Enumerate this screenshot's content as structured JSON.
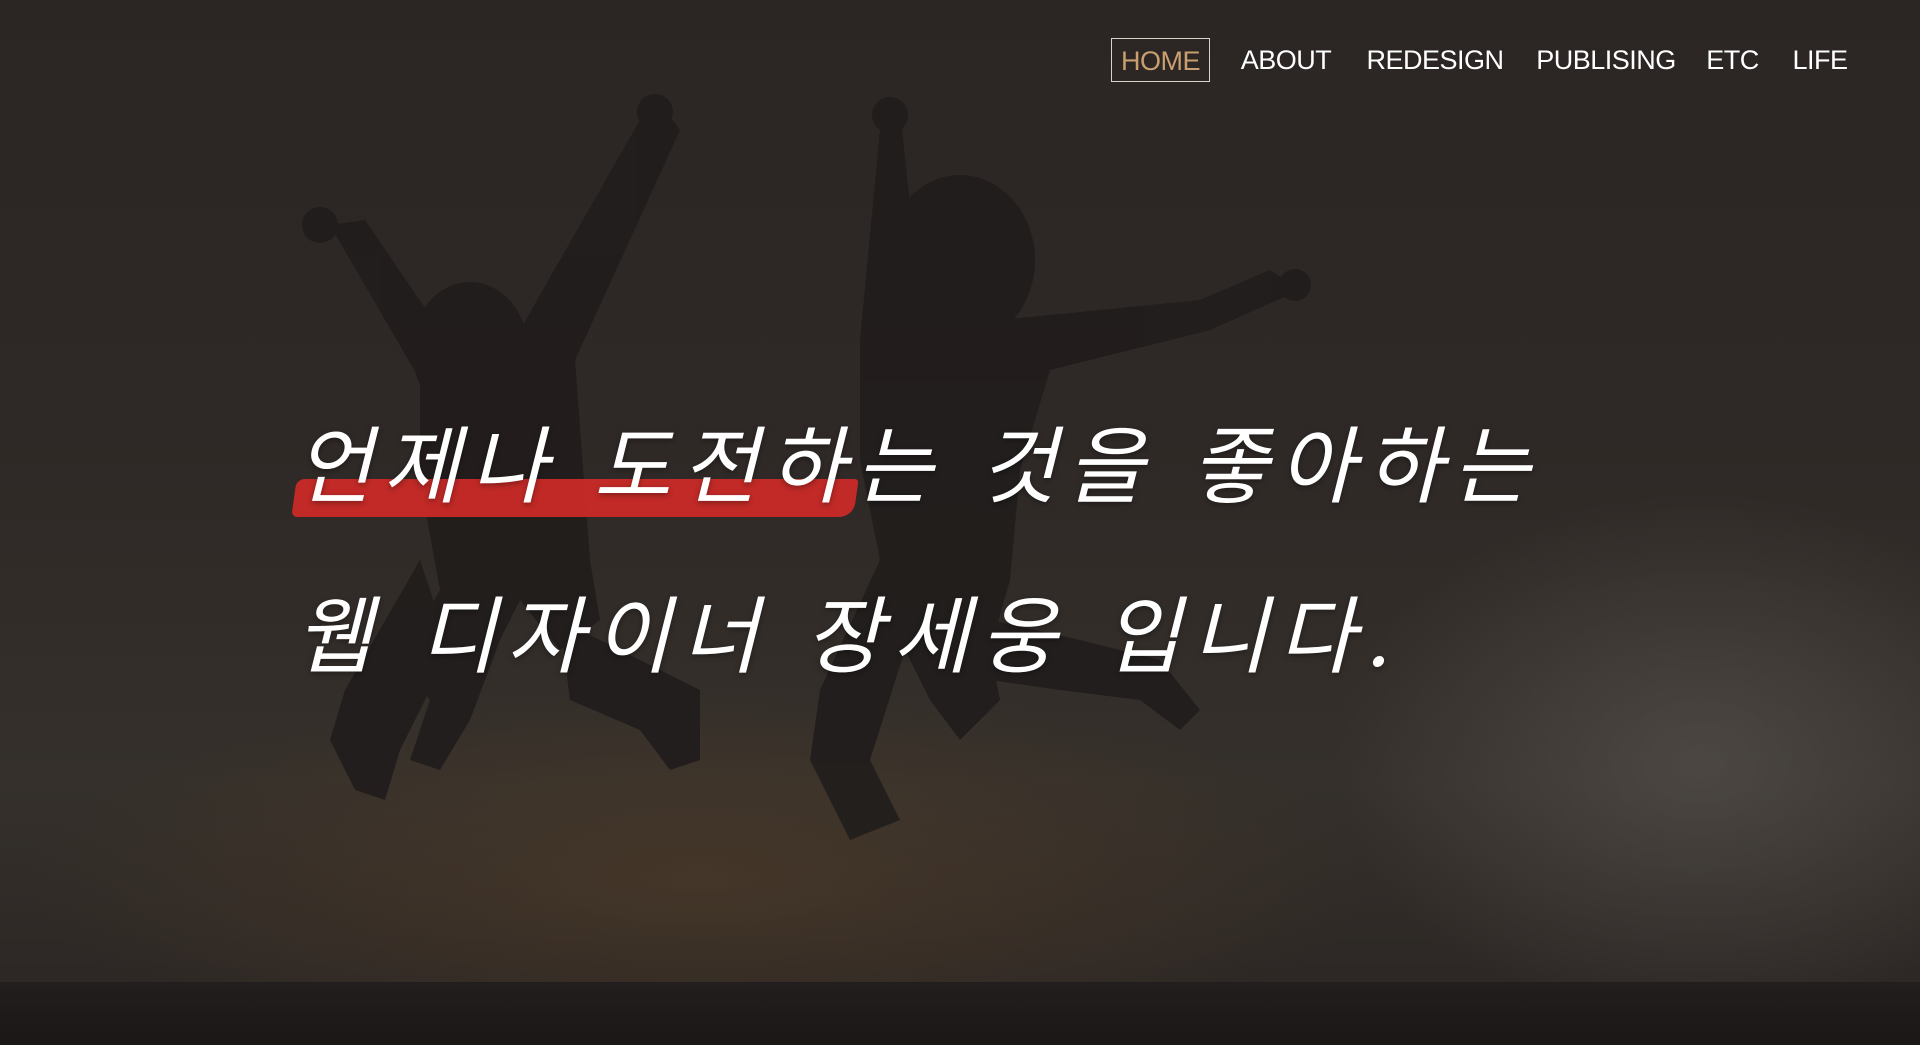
{
  "nav": {
    "items": [
      {
        "label": "HOME",
        "active": true
      },
      {
        "label": "ABOUT",
        "active": false
      },
      {
        "label": "REDESIGN",
        "active": false
      },
      {
        "label": "PUBLISING",
        "active": false
      },
      {
        "label": "ETC",
        "active": false
      },
      {
        "label": "LIFE",
        "active": false
      }
    ]
  },
  "hero": {
    "line1_highlight": "언제나 도전",
    "line1_rest": "하는 것을 좋아하는",
    "line2": "웹 디자이너 장세웅 입니다."
  },
  "colors": {
    "active_nav": "#c89f6e",
    "highlight": "#c92a27",
    "text": "#ffffff"
  }
}
